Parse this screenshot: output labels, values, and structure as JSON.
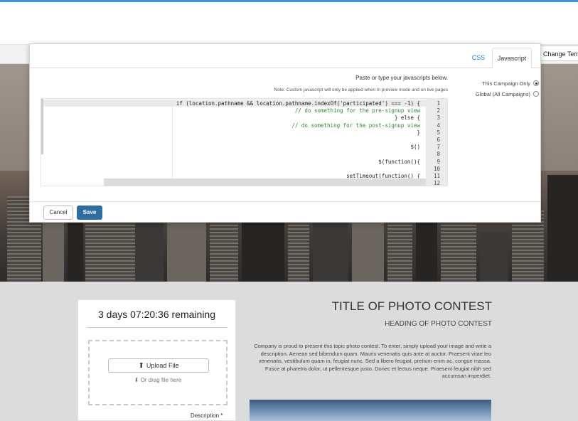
{
  "header": {
    "change_template_label": "Change Tem"
  },
  "modal": {
    "tabs": [
      {
        "label": "Javascript"
      },
      {
        "label": "CSS"
      }
    ],
    "instructions": "Paste or type your javascripts below.",
    "note": "Note: Custom javascript will only be applied when in preview mode and on live pages",
    "scope_options": [
      {
        "label": "This Campaign Only",
        "selected": true
      },
      {
        "label": "Global (All Campaigns)",
        "selected": false
      }
    ],
    "code": [
      {
        "n": "1",
        "text": "if (location.pathname && location.pathname.indexOf('participated') === -1) {"
      },
      {
        "n": "2",
        "text": "    // do something for the pre-signup view"
      },
      {
        "n": "3",
        "text": "} else {"
      },
      {
        "n": "4",
        "text": "    // do something for the post-signup view"
      },
      {
        "n": "5",
        "text": "}"
      },
      {
        "n": "6",
        "text": ""
      },
      {
        "n": "7",
        "text": "$()"
      },
      {
        "n": "8",
        "text": ""
      },
      {
        "n": "9",
        "text": "$(function(){"
      },
      {
        "n": "10",
        "text": ""
      },
      {
        "n": "11",
        "text": "setTimeout(function() {"
      },
      {
        "n": "12",
        "text": ""
      }
    ],
    "save_label": "Save",
    "cancel_label": "Cancel"
  },
  "card": {
    "countdown": "3 days 07:20:36 remaining",
    "upload_label": "Upload File",
    "drag_label": "Or drag file here",
    "description_label": "Description *"
  },
  "contest": {
    "title": "TITLE OF PHOTO CONTEST",
    "heading": "HEADING OF PHOTO CONTEST",
    "body": "Company is proud to present this topic photo contest. To enter, simply upload your image and write a description. Aenean sed bibendum quam. Mauris venenatis quis ante at auctor. Praesent vitae leo venenatis, vestibulum quam in, feugiat nunc. Sed a libero feugiat, pretium enim ac, congue massa. Fusce at pharetra dolor, ut pellentesque justo. Donec et lectus neque. Praesent feugiat nibh sed accumsan imperdiet."
  },
  "colors": {
    "accent": "#3a93d6",
    "save_button": "#2e6da4"
  }
}
